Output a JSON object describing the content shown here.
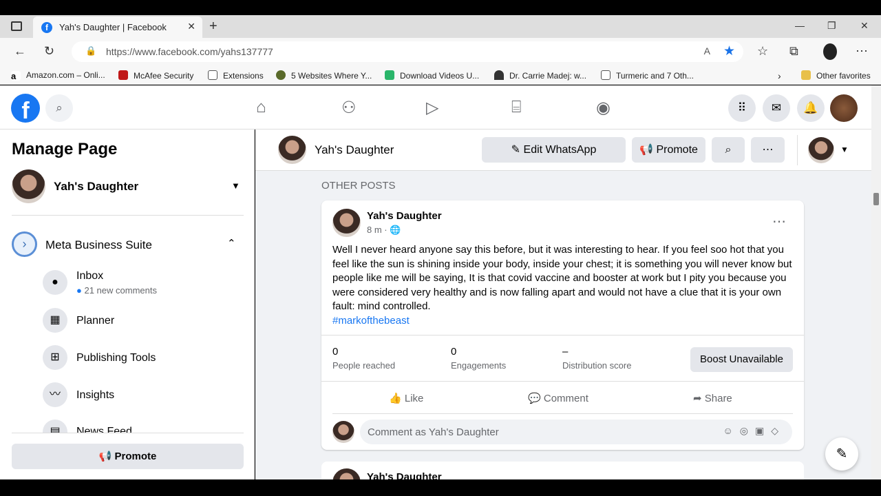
{
  "browser": {
    "tab_title": "Yah's Daughter | Facebook",
    "url": "https://www.facebook.com/yahs137777",
    "bookmarks": [
      "Amazon.com – Onli...",
      "McAfee Security",
      "Extensions",
      "5 Websites Where Y...",
      "Download Videos U...",
      "Dr. Carrie Madej: w...",
      "Turmeric and 7 Oth..."
    ],
    "other_favorites": "Other favorites"
  },
  "left": {
    "title": "Manage Page",
    "page_name": "Yah's Daughter",
    "suite": "Meta Business Suite",
    "menu": [
      {
        "label": "Inbox",
        "sub": "21 new comments",
        "icon": "chat-icon"
      },
      {
        "label": "Planner",
        "icon": "calendar-icon"
      },
      {
        "label": "Publishing Tools",
        "icon": "tools-icon"
      },
      {
        "label": "Insights",
        "icon": "chart-icon"
      },
      {
        "label": "News Feed",
        "icon": "feed-icon"
      }
    ],
    "promote": "Promote"
  },
  "header": {
    "page_name": "Yah's Daughter",
    "edit_whatsapp": "Edit WhatsApp",
    "promote": "Promote"
  },
  "section_title": "OTHER POSTS",
  "post": {
    "author": "Yah's Daughter",
    "time": "8 m ·",
    "body": "Well I never heard anyone say this before, but it was interesting to hear.  If you feel soo hot that you feel like the sun is shining inside your body, inside your chest; it is something you will never know but people like me will be saying, It is that covid vaccine and booster at work but I pity you because you were considered very healthy and  is now falling apart and would not have a clue that it is your own fault: mind controlled.",
    "hashtag": "#markofthebeast",
    "stats": [
      {
        "value": "0",
        "label": "People reached"
      },
      {
        "value": "0",
        "label": "Engagements"
      },
      {
        "value": "–",
        "label": "Distribution score"
      }
    ],
    "boost": "Boost Unavailable",
    "like": "Like",
    "comment": "Comment",
    "share": "Share",
    "comment_placeholder": "Comment as Yah's Daughter"
  },
  "post2": {
    "author": "Yah's Daughter"
  }
}
